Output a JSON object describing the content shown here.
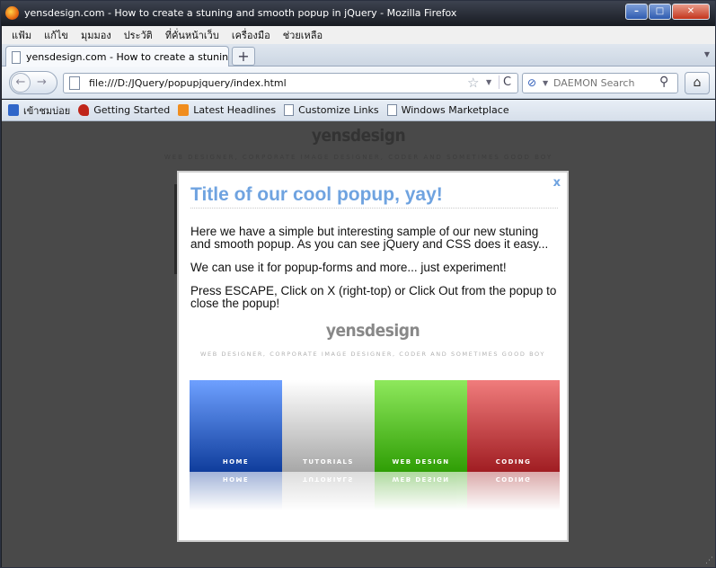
{
  "window": {
    "title": "yensdesign.com - How to create a stuning and smooth popup in jQuery - Mozilla Firefox",
    "minimize_label": "–",
    "maximize_label": "□",
    "close_label": "✕"
  },
  "menu": [
    "แฟ้ม",
    "แก้ไข",
    "มุมมอง",
    "ประวัติ",
    "ที่คั่นหน้าเว็บ",
    "เครื่องมือ",
    "ช่วยเหลือ"
  ],
  "tabs": [
    {
      "label": "yensdesign.com - How to create a stuning a..."
    }
  ],
  "new_tab_label": "+",
  "nav": {
    "back_glyph": "←",
    "forward_glyph": "→",
    "url": "file:///D:/JQuery/popupjquery/index.html",
    "star_glyph": "☆",
    "reload_glyph": "C",
    "search_placeholder": "DAEMON Search",
    "home_glyph": "⌂"
  },
  "bookmarks": [
    {
      "label": "เข้าชมบ่อย",
      "icon": "blue-search-icon"
    },
    {
      "label": "Getting Started",
      "icon": "firefox-red-icon"
    },
    {
      "label": "Latest Headlines",
      "icon": "rss-icon"
    },
    {
      "label": "Customize Links",
      "icon": "page-icon"
    },
    {
      "label": "Windows Marketplace",
      "icon": "page-icon"
    }
  ],
  "page": {
    "bg_logo": "yensdesign",
    "bg_tagline": "WEB DESIGNER, CORPORATE IMAGE DESIGNER, CODER AND SOMETIMES GOOD BOY"
  },
  "popup": {
    "close": "x",
    "title": "Title of our cool popup, yay!",
    "paragraphs": [
      "Here we have a simple but interesting sample of our new stuning and smooth popup. As you can see jQuery and CSS does it easy...",
      "We can use it for popup-forms and more... just experiment!",
      "Press ESCAPE, Click on X (right-top) or Click Out from the popup to close the popup!"
    ],
    "logo": "yensdesign",
    "tagline": "WEB DESIGNER, CORPORATE IMAGE DESIGNER, CODER AND SOMETIMES GOOD BOY",
    "nav_tiles": [
      "HOME",
      "TUTORIALS",
      "WEB DESIGN",
      "CODING"
    ]
  },
  "colors": {
    "popup_title": "#6fa3e0",
    "overlay": "#494949"
  }
}
